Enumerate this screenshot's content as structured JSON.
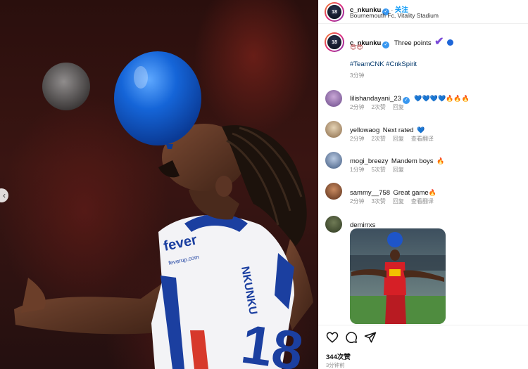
{
  "post": {
    "author": "c_nkunku",
    "follow_label": "关注",
    "location": "Bournemouth Fc, Vitality Stadium",
    "avatar_number": "18"
  },
  "caption": {
    "author": "c_nkunku",
    "text": "Three points",
    "emoji_line": "😎😎",
    "hashtags": "#TeamCNK #CnkSpirit",
    "time": "3分钟"
  },
  "photo": {
    "sponsor": "fever",
    "sponsor_url": "feverup.com",
    "shirt_number": "18",
    "shirt_name": "NKUNKU"
  },
  "comments": [
    {
      "user": "lilishandayani_23",
      "text": "",
      "emoji": "💙💙💙💙🔥🔥🔥",
      "time": "2分钟",
      "likes": "2次赞",
      "reply": "回复",
      "translate": "",
      "verified": true
    },
    {
      "user": "yellowaog",
      "text": "Next rated",
      "emoji": "💙",
      "time": "2分钟",
      "likes": "2次赞",
      "reply": "回复",
      "translate": "查看翻译",
      "verified": false
    },
    {
      "user": "mogi_breezy",
      "text": "Mandem boys",
      "emoji": "🔥",
      "time": "1分钟",
      "likes": "5次赞",
      "reply": "回复",
      "translate": "",
      "verified": false
    },
    {
      "user": "sammy__758",
      "text": "Great game",
      "emoji": "🔥",
      "time": "2分钟",
      "likes": "3次赞",
      "reply": "回复",
      "translate": "查看翻译",
      "verified": false
    },
    {
      "user": "demirrxs",
      "text": "",
      "emoji": "",
      "time": "",
      "likes": "",
      "reply": "",
      "translate": "",
      "verified": false
    }
  ],
  "footer": {
    "likes": "344次赞",
    "ago": "3分钟前"
  },
  "icons": {
    "like": "heart-outline-icon",
    "comment": "comment-bubble-icon",
    "share": "paper-plane-icon",
    "verified": "verified-badge-icon",
    "prev": "chevron-left-icon"
  },
  "colors": {
    "link_blue": "#0095f6",
    "hashtag": "#00376b",
    "verified": "#3897f0",
    "balloon": "#1565d8"
  }
}
